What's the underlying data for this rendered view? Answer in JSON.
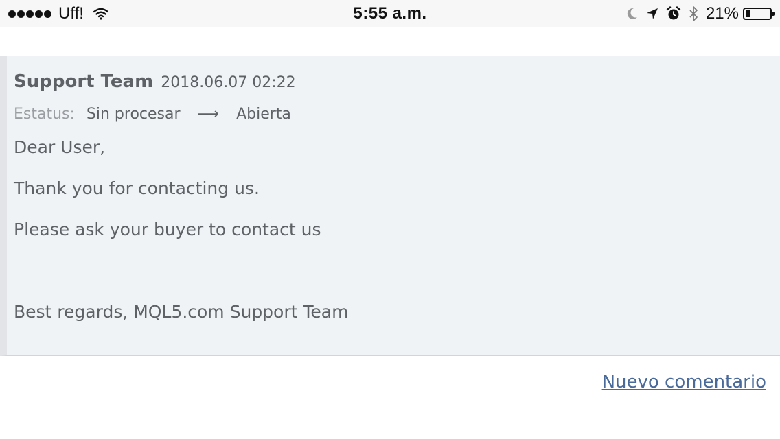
{
  "status_bar": {
    "carrier": "Uff!",
    "time": "5:55 a.m.",
    "battery_percent": "21%",
    "battery_level": 0.21,
    "icons": [
      "signal-dots-icon",
      "wifi-icon",
      "moon-icon",
      "location-arrow-icon",
      "alarm-icon",
      "bluetooth-icon",
      "battery-icon"
    ]
  },
  "message": {
    "author": "Support Team",
    "date": "2018.06.07 02:22",
    "status_label": "Estatus:",
    "status_from": "Sin procesar",
    "status_arrow": "⟶",
    "status_to": "Abierta",
    "lines": [
      "Dear User,",
      "Thank you for contacting us.",
      "Please ask your buyer to contact us",
      "Best regards, MQL5.com Support Team"
    ]
  },
  "actions": {
    "new_comment": "Nuevo comentario"
  },
  "colors": {
    "message_bg": "#f0f3f6",
    "text": "#5e6266",
    "muted": "#9a9ea2",
    "link": "#4a6a9a"
  }
}
